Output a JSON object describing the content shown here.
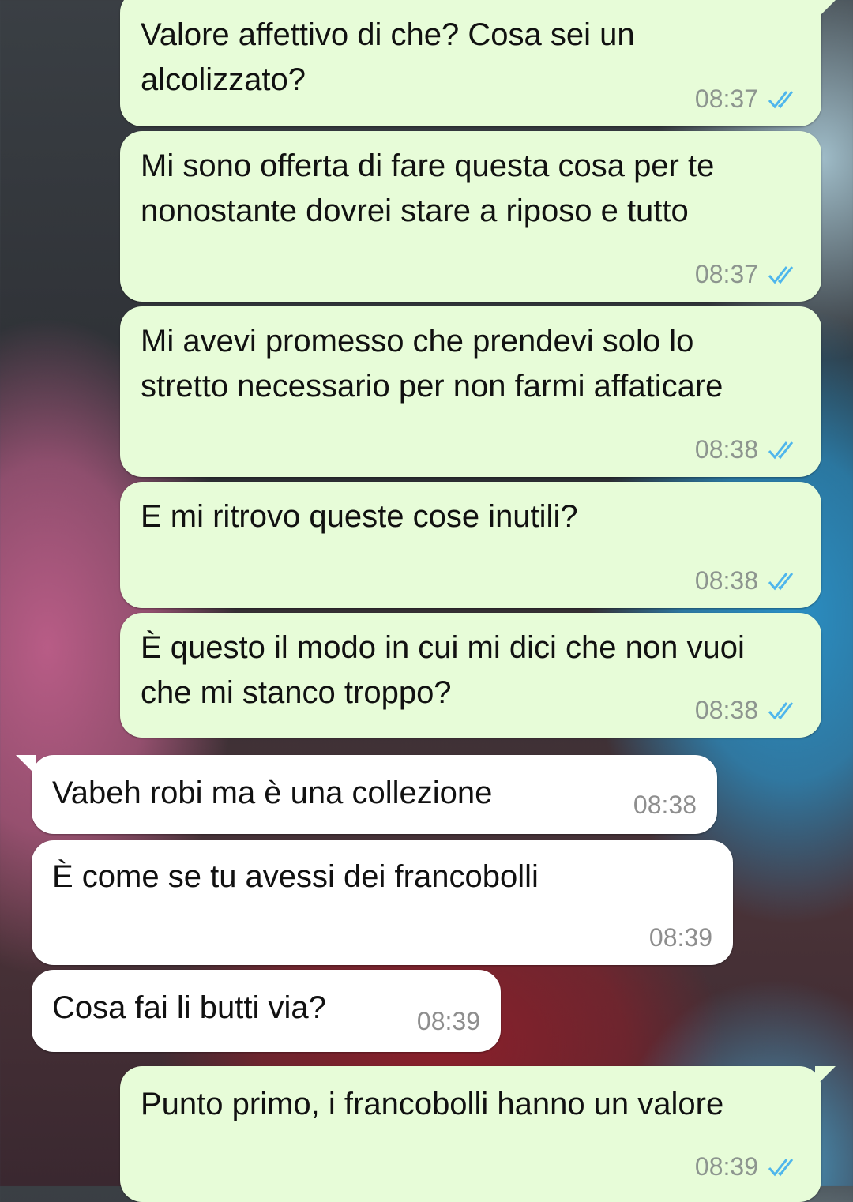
{
  "messages": [
    {
      "dir": "out",
      "text": "Valore affettivo di che? Cosa sei un alcolizzato?",
      "time": "08:37",
      "status_icon": "double-check-blue"
    },
    {
      "dir": "out",
      "text": "Mi sono offerta di fare questa cosa per te nonostante dovrei stare a riposo e tutto",
      "time": "08:37",
      "status_icon": "double-check-blue"
    },
    {
      "dir": "out",
      "text": "Mi avevi promesso che prendevi solo lo stretto necessario per non farmi affaticare",
      "time": "08:38",
      "status_icon": "double-check-blue"
    },
    {
      "dir": "out",
      "text": "E mi ritrovo queste cose inutili?",
      "time": "08:38",
      "status_icon": "double-check-blue"
    },
    {
      "dir": "out",
      "text": "È questo il modo in cui mi dici che non vuoi che mi stanco troppo?",
      "time": "08:38",
      "status_icon": "double-check-blue"
    },
    {
      "dir": "in",
      "text": "Vabeh robi ma è una collezione",
      "time": "08:38"
    },
    {
      "dir": "in",
      "text": "È come se tu avessi dei francobolli",
      "time": "08:39"
    },
    {
      "dir": "in",
      "text": "Cosa fai li butti via?",
      "time": "08:39"
    },
    {
      "dir": "out",
      "text": "Punto primo, i francobolli hanno un valore",
      "time": "08:39",
      "status_icon": "double-check-blue"
    }
  ],
  "colors": {
    "outgoing_bubble": "#e7fcd8",
    "incoming_bubble": "#ffffff",
    "read_tick": "#4fb6ec",
    "timestamp": "#8d958f"
  }
}
